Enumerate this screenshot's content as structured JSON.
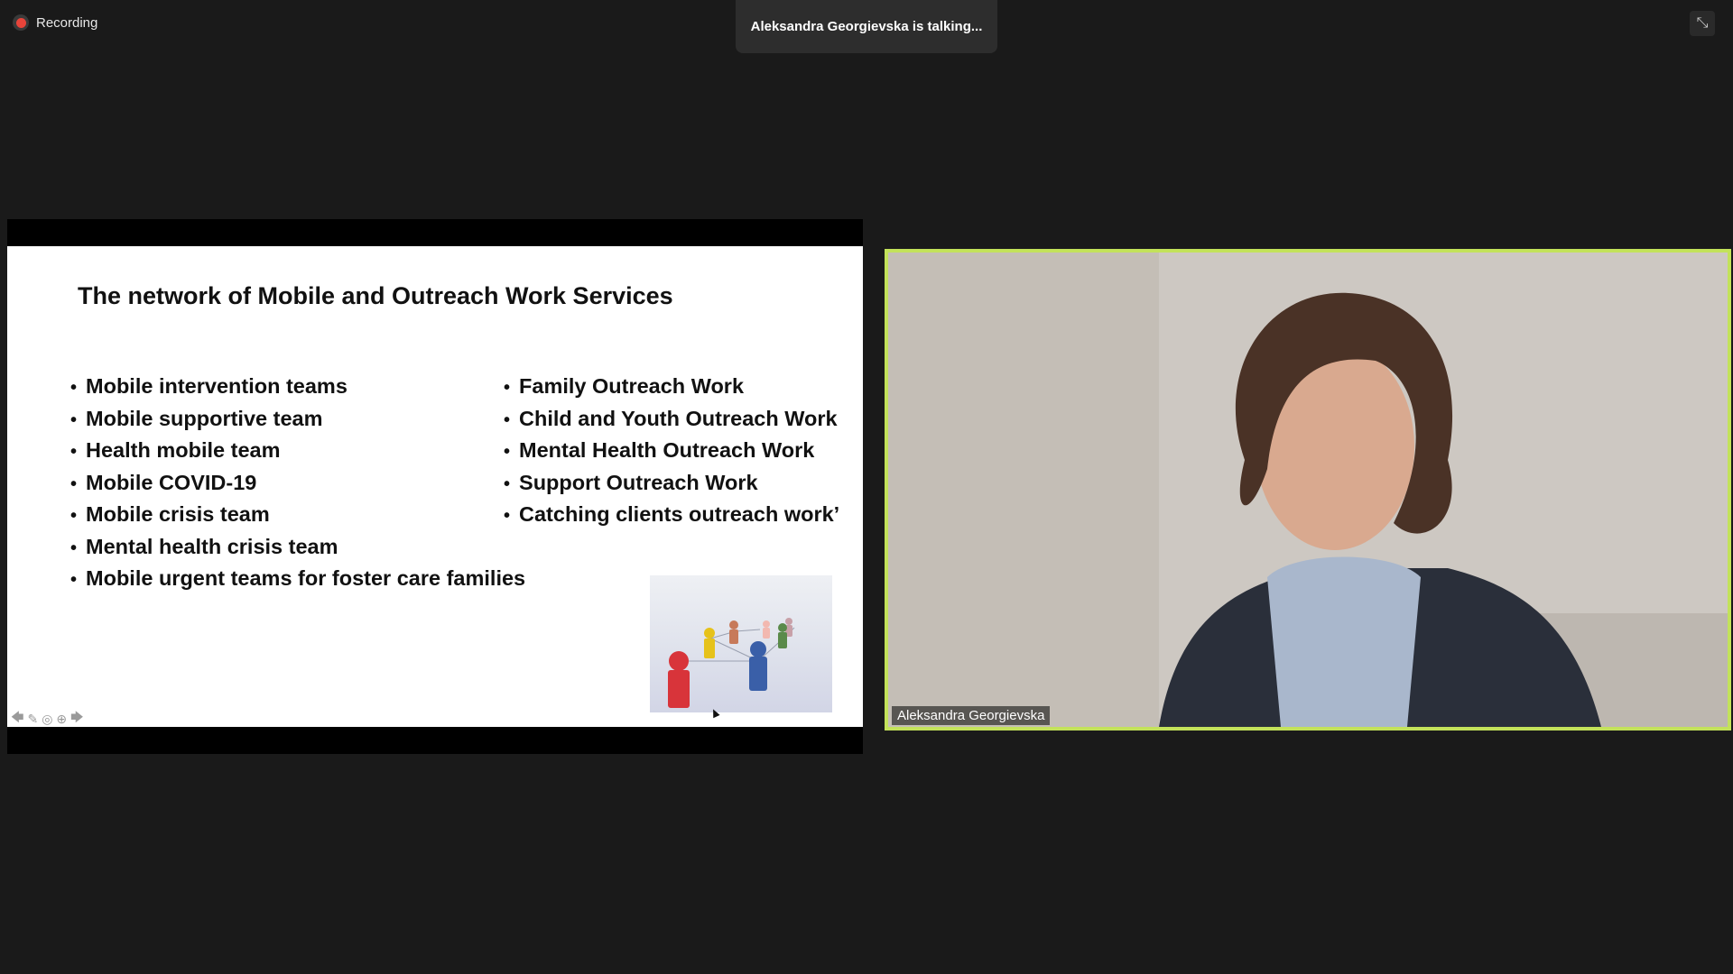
{
  "recording": {
    "label": "Recording"
  },
  "active_speaker": {
    "text": "Aleksandra Georgievska is talking..."
  },
  "slide": {
    "title": "The network of Mobile and Outreach Work Services",
    "left_bullets": [
      "Mobile intervention teams",
      "Mobile supportive team",
      "Health mobile team",
      "Mobile COVID-19",
      "Mobile crisis team",
      "Mental health crisis team",
      "Mobile urgent teams for foster care families"
    ],
    "right_bullets": [
      "Family Outreach Work",
      "Child and Youth Outreach Work",
      "Mental Health Outreach Work",
      "Support Outreach Work",
      "Catching clients outreach work’"
    ]
  },
  "participant": {
    "name": "Aleksandra Georgievska"
  },
  "colors": {
    "background": "#1a1a1a",
    "speaker_border": "#c3e25a",
    "recording": "#e8443a"
  },
  "icons": [
    "record-icon",
    "minimize-icon",
    "prev-slide-icon",
    "pen-icon",
    "pointer-icon",
    "more-icon",
    "next-slide-icon"
  ]
}
